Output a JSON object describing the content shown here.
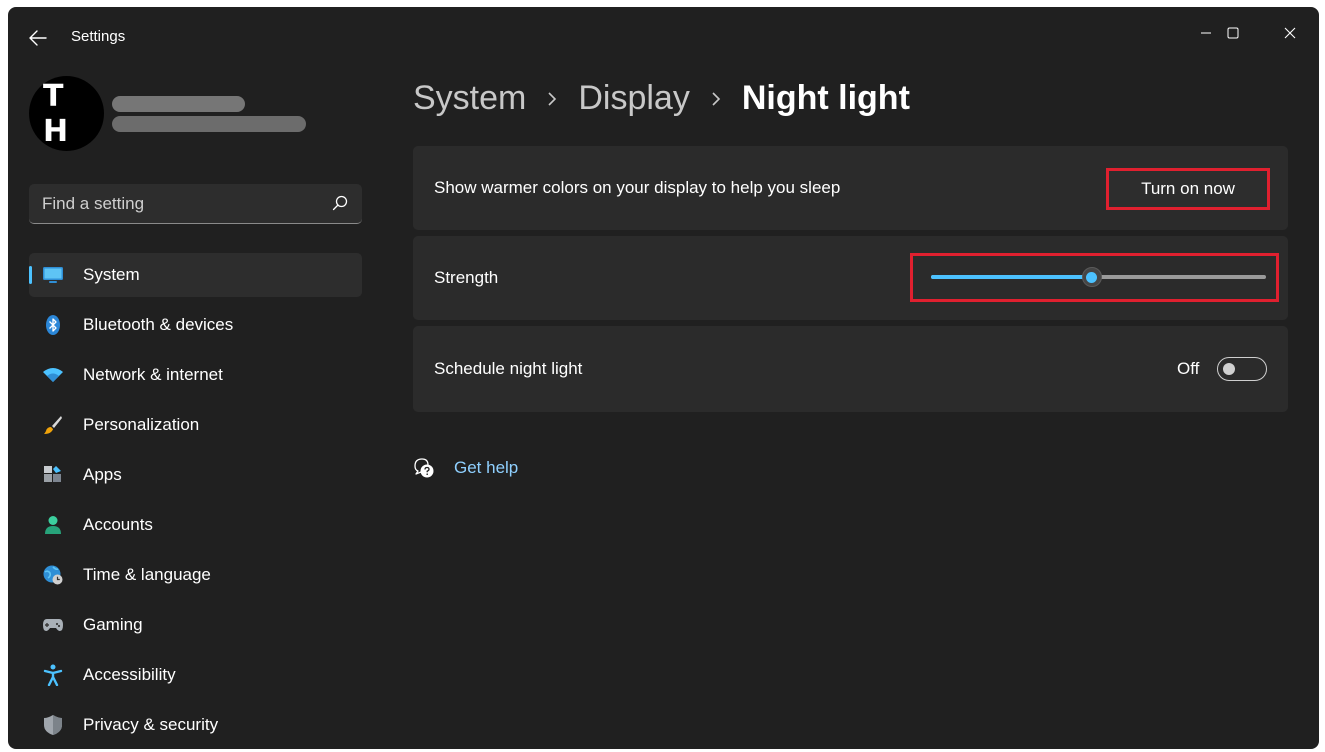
{
  "window": {
    "title": "Settings"
  },
  "account": {
    "avatar_initials": "T H"
  },
  "search": {
    "placeholder": "Find a setting"
  },
  "sidebar": {
    "items": [
      {
        "label": "System",
        "icon": "monitor-icon",
        "active": true
      },
      {
        "label": "Bluetooth & devices",
        "icon": "bluetooth-icon"
      },
      {
        "label": "Network & internet",
        "icon": "wifi-icon"
      },
      {
        "label": "Personalization",
        "icon": "brush-icon"
      },
      {
        "label": "Apps",
        "icon": "apps-icon"
      },
      {
        "label": "Accounts",
        "icon": "person-icon"
      },
      {
        "label": "Time & language",
        "icon": "globe-clock-icon"
      },
      {
        "label": "Gaming",
        "icon": "gamepad-icon"
      },
      {
        "label": "Accessibility",
        "icon": "accessibility-icon"
      },
      {
        "label": "Privacy & security",
        "icon": "shield-icon"
      }
    ]
  },
  "breadcrumb": {
    "items": [
      "System",
      "Display"
    ],
    "current": "Night light"
  },
  "settings": {
    "warmer": {
      "label": "Show warmer colors on your display to help you sleep",
      "button_label": "Turn on now"
    },
    "strength": {
      "label": "Strength",
      "value_fraction": 0.48
    },
    "schedule": {
      "label": "Schedule night light",
      "state_label": "Off",
      "on": false
    }
  },
  "help": {
    "label": "Get help"
  },
  "colors": {
    "accent": "#4cc2ff",
    "highlight_box": "#e0202f",
    "background": "#202020",
    "card": "#2b2b2b"
  }
}
